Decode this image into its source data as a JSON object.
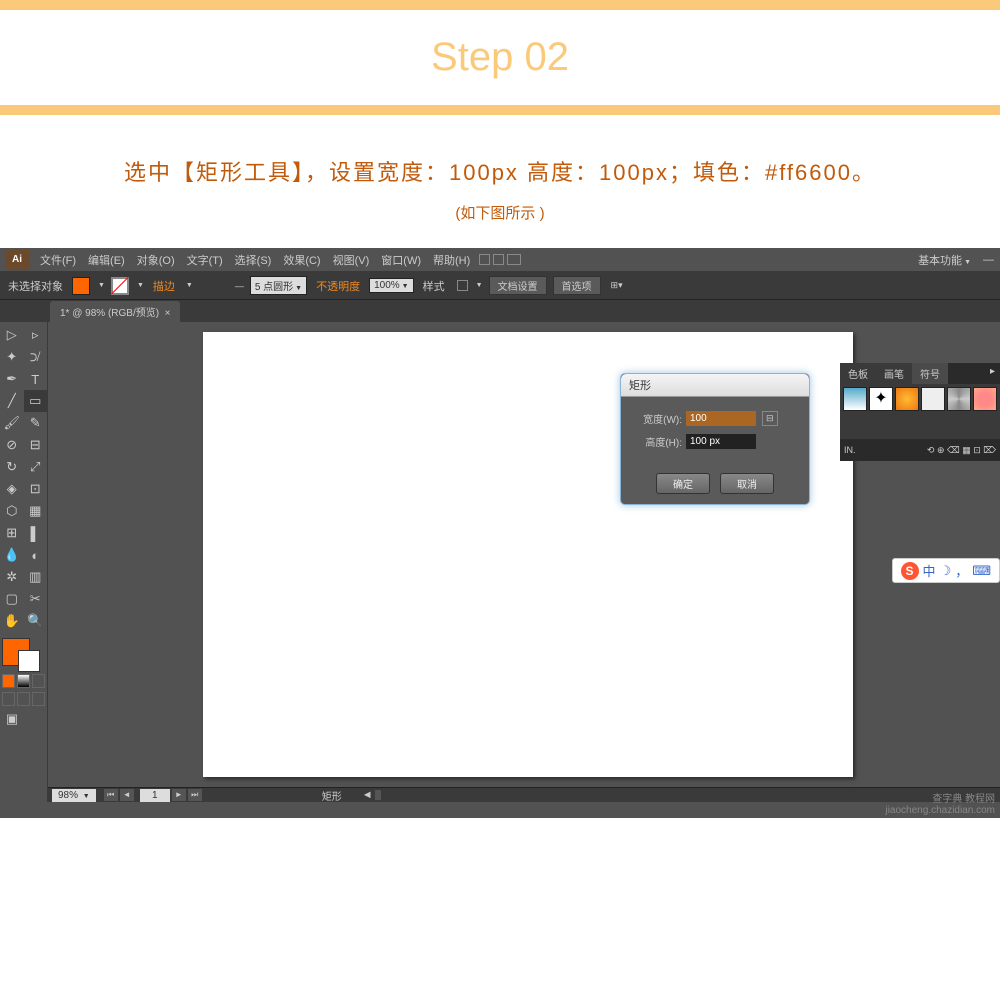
{
  "header": {
    "title": "Step 02",
    "instruction": "选中【矩形工具】，设置宽度：100px  高度：100px；填色：#ff6600。",
    "sub": "(如下图所示 )"
  },
  "menubar": {
    "logo": "Ai",
    "items": [
      "文件(F)",
      "编辑(E)",
      "对象(O)",
      "文字(T)",
      "选择(S)",
      "效果(C)",
      "视图(V)",
      "窗口(W)",
      "帮助(H)"
    ],
    "right_label": "基本功能"
  },
  "controlbar": {
    "selection": "未选择对象",
    "stroke_label": "描边",
    "stroke_weight_field": "5 点圆形",
    "opacity_label": "不透明度",
    "opacity_value": "100%",
    "style_label": "样式",
    "doc_setup": "文档设置",
    "prefs": "首选项"
  },
  "document": {
    "tab_label": "1* @ 98% (RGB/预览)",
    "zoom": "98%",
    "artboard_num": "1",
    "status_tool": "矩形"
  },
  "dialog": {
    "title": "矩形",
    "width_label": "宽度(W):",
    "width_value": "100",
    "height_label": "高度(H):",
    "height_value": "100 px",
    "ok": "确定",
    "cancel": "取消"
  },
  "panel": {
    "tab1": "色板",
    "tab2": "画笔",
    "tab3": "符号",
    "footer": "IN."
  },
  "ime": {
    "s": "S",
    "mode": "中",
    "punct": "，"
  },
  "watermark": {
    "line1": "查字典 教程网",
    "line2": "jiaocheng.chazidian.com"
  },
  "colors": {
    "fill": "#ff6600"
  }
}
